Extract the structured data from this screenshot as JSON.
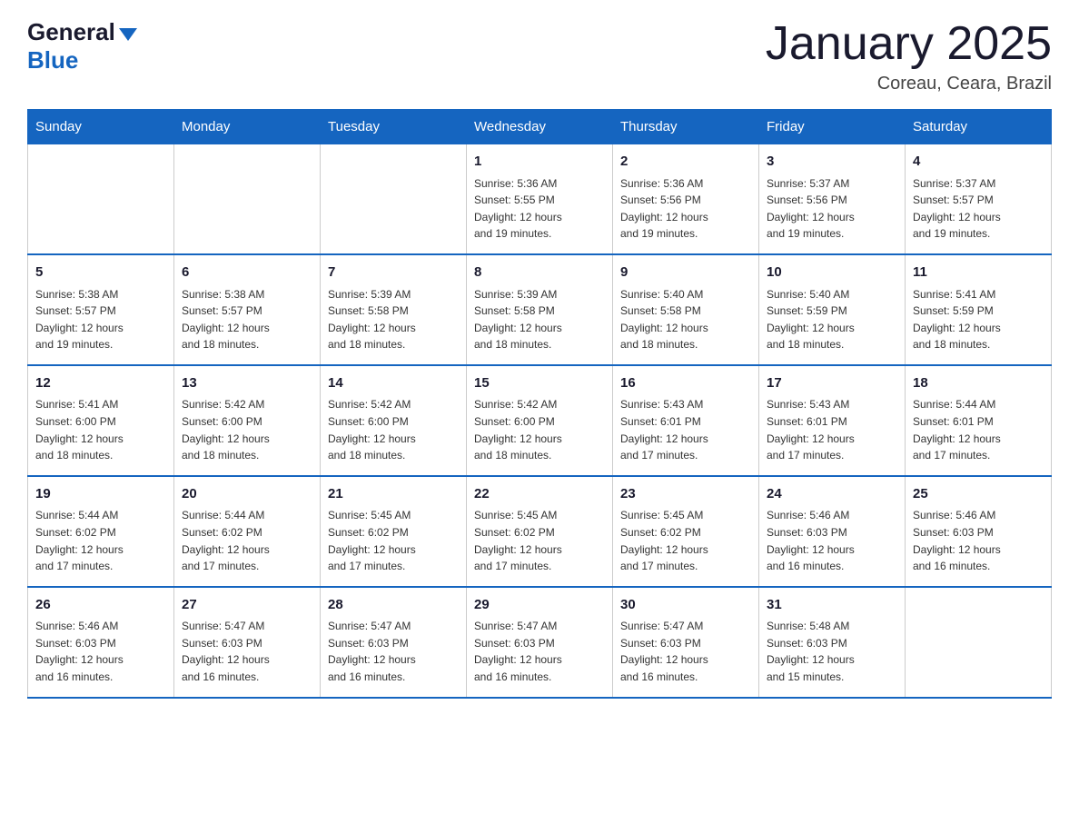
{
  "header": {
    "logo": {
      "part1": "General",
      "part2": "Blue"
    },
    "title": "January 2025",
    "subtitle": "Coreau, Ceara, Brazil"
  },
  "days_of_week": [
    "Sunday",
    "Monday",
    "Tuesday",
    "Wednesday",
    "Thursday",
    "Friday",
    "Saturday"
  ],
  "weeks": [
    [
      {
        "day": "",
        "info": ""
      },
      {
        "day": "",
        "info": ""
      },
      {
        "day": "",
        "info": ""
      },
      {
        "day": "1",
        "info": "Sunrise: 5:36 AM\nSunset: 5:55 PM\nDaylight: 12 hours\nand 19 minutes."
      },
      {
        "day": "2",
        "info": "Sunrise: 5:36 AM\nSunset: 5:56 PM\nDaylight: 12 hours\nand 19 minutes."
      },
      {
        "day": "3",
        "info": "Sunrise: 5:37 AM\nSunset: 5:56 PM\nDaylight: 12 hours\nand 19 minutes."
      },
      {
        "day": "4",
        "info": "Sunrise: 5:37 AM\nSunset: 5:57 PM\nDaylight: 12 hours\nand 19 minutes."
      }
    ],
    [
      {
        "day": "5",
        "info": "Sunrise: 5:38 AM\nSunset: 5:57 PM\nDaylight: 12 hours\nand 19 minutes."
      },
      {
        "day": "6",
        "info": "Sunrise: 5:38 AM\nSunset: 5:57 PM\nDaylight: 12 hours\nand 18 minutes."
      },
      {
        "day": "7",
        "info": "Sunrise: 5:39 AM\nSunset: 5:58 PM\nDaylight: 12 hours\nand 18 minutes."
      },
      {
        "day": "8",
        "info": "Sunrise: 5:39 AM\nSunset: 5:58 PM\nDaylight: 12 hours\nand 18 minutes."
      },
      {
        "day": "9",
        "info": "Sunrise: 5:40 AM\nSunset: 5:58 PM\nDaylight: 12 hours\nand 18 minutes."
      },
      {
        "day": "10",
        "info": "Sunrise: 5:40 AM\nSunset: 5:59 PM\nDaylight: 12 hours\nand 18 minutes."
      },
      {
        "day": "11",
        "info": "Sunrise: 5:41 AM\nSunset: 5:59 PM\nDaylight: 12 hours\nand 18 minutes."
      }
    ],
    [
      {
        "day": "12",
        "info": "Sunrise: 5:41 AM\nSunset: 6:00 PM\nDaylight: 12 hours\nand 18 minutes."
      },
      {
        "day": "13",
        "info": "Sunrise: 5:42 AM\nSunset: 6:00 PM\nDaylight: 12 hours\nand 18 minutes."
      },
      {
        "day": "14",
        "info": "Sunrise: 5:42 AM\nSunset: 6:00 PM\nDaylight: 12 hours\nand 18 minutes."
      },
      {
        "day": "15",
        "info": "Sunrise: 5:42 AM\nSunset: 6:00 PM\nDaylight: 12 hours\nand 18 minutes."
      },
      {
        "day": "16",
        "info": "Sunrise: 5:43 AM\nSunset: 6:01 PM\nDaylight: 12 hours\nand 17 minutes."
      },
      {
        "day": "17",
        "info": "Sunrise: 5:43 AM\nSunset: 6:01 PM\nDaylight: 12 hours\nand 17 minutes."
      },
      {
        "day": "18",
        "info": "Sunrise: 5:44 AM\nSunset: 6:01 PM\nDaylight: 12 hours\nand 17 minutes."
      }
    ],
    [
      {
        "day": "19",
        "info": "Sunrise: 5:44 AM\nSunset: 6:02 PM\nDaylight: 12 hours\nand 17 minutes."
      },
      {
        "day": "20",
        "info": "Sunrise: 5:44 AM\nSunset: 6:02 PM\nDaylight: 12 hours\nand 17 minutes."
      },
      {
        "day": "21",
        "info": "Sunrise: 5:45 AM\nSunset: 6:02 PM\nDaylight: 12 hours\nand 17 minutes."
      },
      {
        "day": "22",
        "info": "Sunrise: 5:45 AM\nSunset: 6:02 PM\nDaylight: 12 hours\nand 17 minutes."
      },
      {
        "day": "23",
        "info": "Sunrise: 5:45 AM\nSunset: 6:02 PM\nDaylight: 12 hours\nand 17 minutes."
      },
      {
        "day": "24",
        "info": "Sunrise: 5:46 AM\nSunset: 6:03 PM\nDaylight: 12 hours\nand 16 minutes."
      },
      {
        "day": "25",
        "info": "Sunrise: 5:46 AM\nSunset: 6:03 PM\nDaylight: 12 hours\nand 16 minutes."
      }
    ],
    [
      {
        "day": "26",
        "info": "Sunrise: 5:46 AM\nSunset: 6:03 PM\nDaylight: 12 hours\nand 16 minutes."
      },
      {
        "day": "27",
        "info": "Sunrise: 5:47 AM\nSunset: 6:03 PM\nDaylight: 12 hours\nand 16 minutes."
      },
      {
        "day": "28",
        "info": "Sunrise: 5:47 AM\nSunset: 6:03 PM\nDaylight: 12 hours\nand 16 minutes."
      },
      {
        "day": "29",
        "info": "Sunrise: 5:47 AM\nSunset: 6:03 PM\nDaylight: 12 hours\nand 16 minutes."
      },
      {
        "day": "30",
        "info": "Sunrise: 5:47 AM\nSunset: 6:03 PM\nDaylight: 12 hours\nand 16 minutes."
      },
      {
        "day": "31",
        "info": "Sunrise: 5:48 AM\nSunset: 6:03 PM\nDaylight: 12 hours\nand 15 minutes."
      },
      {
        "day": "",
        "info": ""
      }
    ]
  ]
}
